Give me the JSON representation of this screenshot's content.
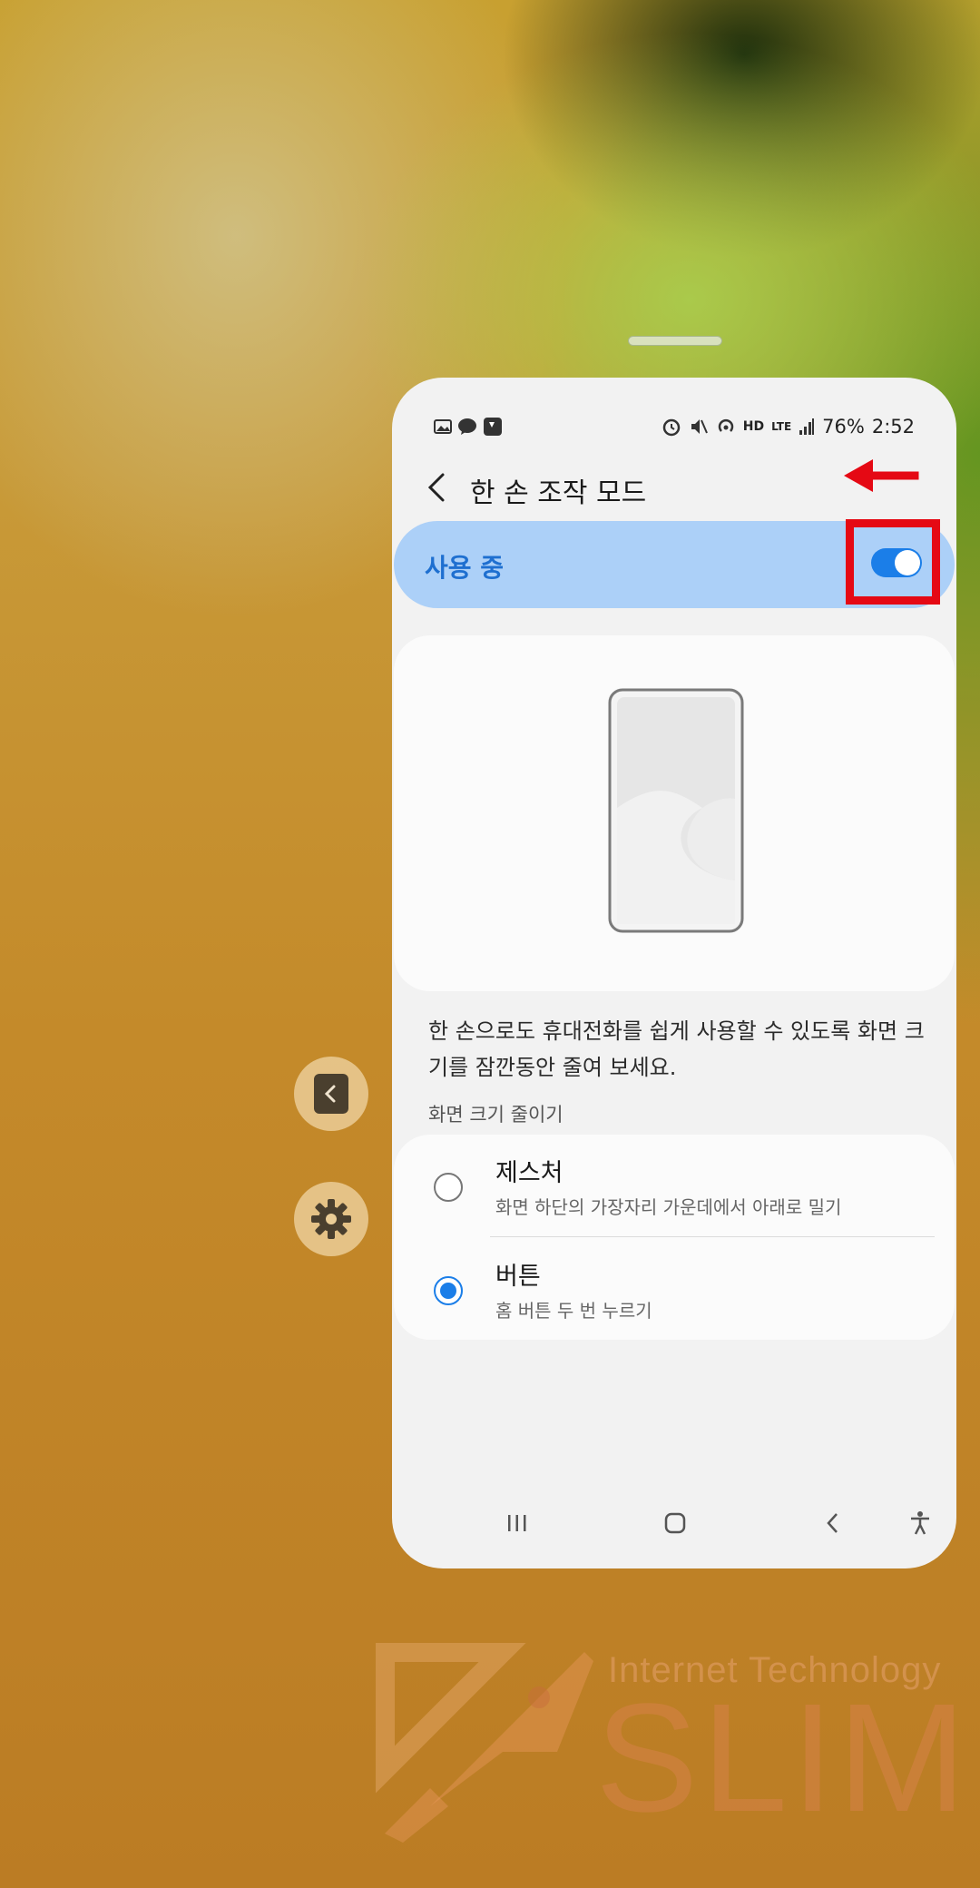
{
  "status_bar": {
    "battery": "76%",
    "time": "2:52",
    "network_label": "HD",
    "lte_label": "LTE"
  },
  "header": {
    "title": "한 손 조작 모드"
  },
  "toggle": {
    "label": "사용 중",
    "enabled": true
  },
  "description": "한 손으로도 휴대전화를 쉽게 사용할 수 있도록 화면 크기를 잠깐동안 줄여 보세요.",
  "section_label": "화면 크기 줄이기",
  "options": [
    {
      "title": "제스처",
      "subtitle": "화면 하단의 가장자리 가운데에서 아래로 밀기",
      "selected": false
    },
    {
      "title": "버튼",
      "subtitle": "홈 버튼 두 번 누르기",
      "selected": true
    }
  ],
  "watermark": {
    "tagline": "Internet Technology",
    "brand": "SLIM"
  },
  "colors": {
    "accent": "#1b7ee8",
    "toggle_row_bg": "#acd0f8",
    "annotation_red": "#e50914"
  }
}
